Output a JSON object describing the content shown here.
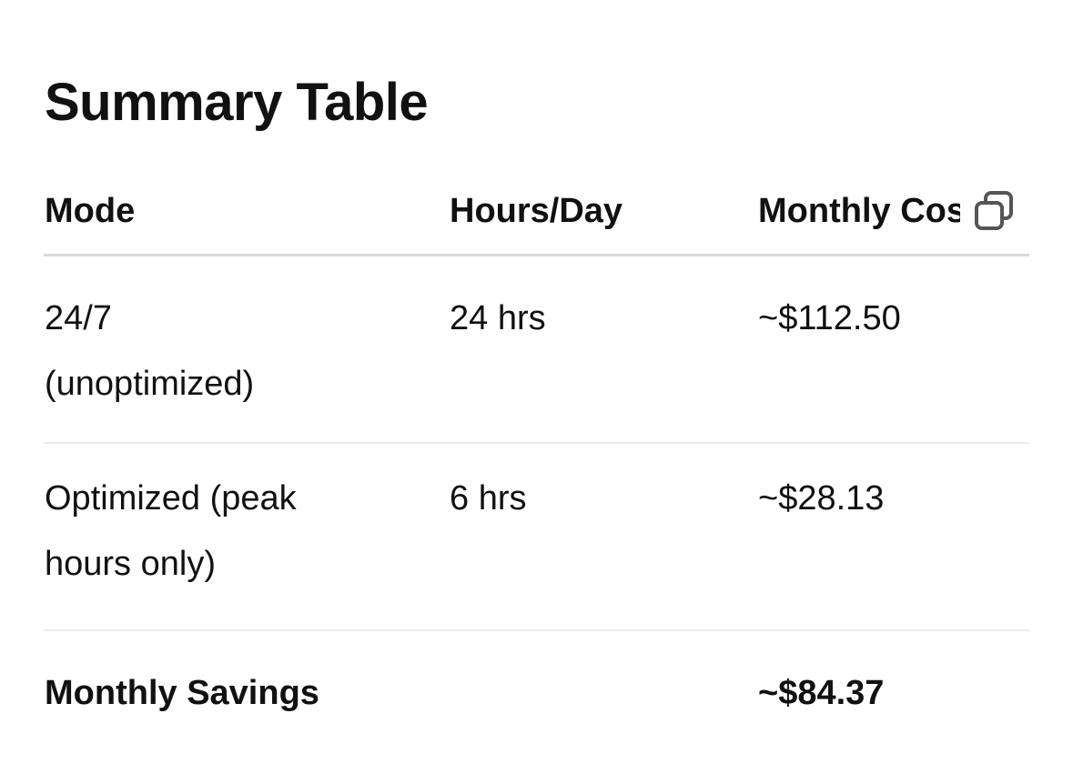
{
  "title": "Summary Table",
  "table": {
    "headers": [
      "Mode",
      "Hours/Day",
      "Monthly Cost"
    ],
    "rows": [
      [
        "24/7 (unoptimized)",
        "24 hrs",
        "~$112.50"
      ],
      [
        "Optimized (peak hours only)",
        "6 hrs",
        "~$28.13"
      ],
      [
        "Monthly Savings",
        "",
        "~$84.37"
      ]
    ]
  },
  "icons": {
    "copy": "copy-icon"
  },
  "colors": {
    "text": "#111111",
    "header_divider": "#d9d9d9",
    "row_divider": "#ececec",
    "icon": "#555555"
  }
}
